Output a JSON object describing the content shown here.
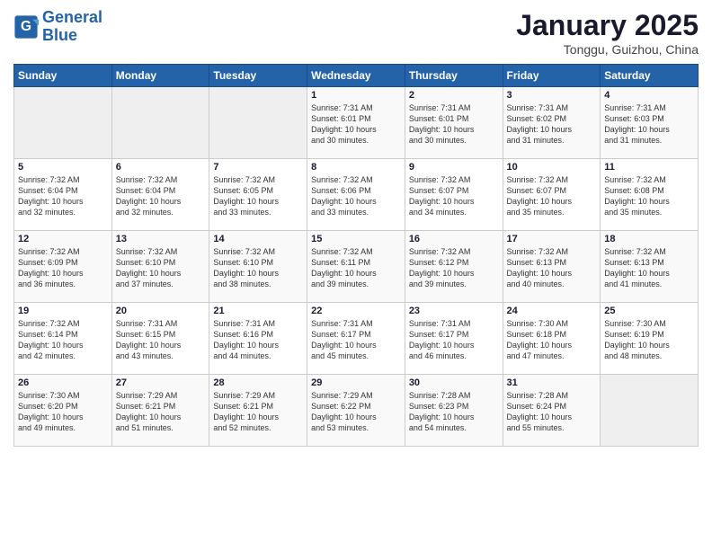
{
  "header": {
    "logo_line1": "General",
    "logo_line2": "Blue",
    "month_title": "January 2025",
    "location": "Tonggu, Guizhou, China"
  },
  "weekdays": [
    "Sunday",
    "Monday",
    "Tuesday",
    "Wednesday",
    "Thursday",
    "Friday",
    "Saturday"
  ],
  "weeks": [
    [
      {
        "day": "",
        "info": ""
      },
      {
        "day": "",
        "info": ""
      },
      {
        "day": "",
        "info": ""
      },
      {
        "day": "1",
        "info": "Sunrise: 7:31 AM\nSunset: 6:01 PM\nDaylight: 10 hours\nand 30 minutes."
      },
      {
        "day": "2",
        "info": "Sunrise: 7:31 AM\nSunset: 6:01 PM\nDaylight: 10 hours\nand 30 minutes."
      },
      {
        "day": "3",
        "info": "Sunrise: 7:31 AM\nSunset: 6:02 PM\nDaylight: 10 hours\nand 31 minutes."
      },
      {
        "day": "4",
        "info": "Sunrise: 7:31 AM\nSunset: 6:03 PM\nDaylight: 10 hours\nand 31 minutes."
      }
    ],
    [
      {
        "day": "5",
        "info": "Sunrise: 7:32 AM\nSunset: 6:04 PM\nDaylight: 10 hours\nand 32 minutes."
      },
      {
        "day": "6",
        "info": "Sunrise: 7:32 AM\nSunset: 6:04 PM\nDaylight: 10 hours\nand 32 minutes."
      },
      {
        "day": "7",
        "info": "Sunrise: 7:32 AM\nSunset: 6:05 PM\nDaylight: 10 hours\nand 33 minutes."
      },
      {
        "day": "8",
        "info": "Sunrise: 7:32 AM\nSunset: 6:06 PM\nDaylight: 10 hours\nand 33 minutes."
      },
      {
        "day": "9",
        "info": "Sunrise: 7:32 AM\nSunset: 6:07 PM\nDaylight: 10 hours\nand 34 minutes."
      },
      {
        "day": "10",
        "info": "Sunrise: 7:32 AM\nSunset: 6:07 PM\nDaylight: 10 hours\nand 35 minutes."
      },
      {
        "day": "11",
        "info": "Sunrise: 7:32 AM\nSunset: 6:08 PM\nDaylight: 10 hours\nand 35 minutes."
      }
    ],
    [
      {
        "day": "12",
        "info": "Sunrise: 7:32 AM\nSunset: 6:09 PM\nDaylight: 10 hours\nand 36 minutes."
      },
      {
        "day": "13",
        "info": "Sunrise: 7:32 AM\nSunset: 6:10 PM\nDaylight: 10 hours\nand 37 minutes."
      },
      {
        "day": "14",
        "info": "Sunrise: 7:32 AM\nSunset: 6:10 PM\nDaylight: 10 hours\nand 38 minutes."
      },
      {
        "day": "15",
        "info": "Sunrise: 7:32 AM\nSunset: 6:11 PM\nDaylight: 10 hours\nand 39 minutes."
      },
      {
        "day": "16",
        "info": "Sunrise: 7:32 AM\nSunset: 6:12 PM\nDaylight: 10 hours\nand 39 minutes."
      },
      {
        "day": "17",
        "info": "Sunrise: 7:32 AM\nSunset: 6:13 PM\nDaylight: 10 hours\nand 40 minutes."
      },
      {
        "day": "18",
        "info": "Sunrise: 7:32 AM\nSunset: 6:13 PM\nDaylight: 10 hours\nand 41 minutes."
      }
    ],
    [
      {
        "day": "19",
        "info": "Sunrise: 7:32 AM\nSunset: 6:14 PM\nDaylight: 10 hours\nand 42 minutes."
      },
      {
        "day": "20",
        "info": "Sunrise: 7:31 AM\nSunset: 6:15 PM\nDaylight: 10 hours\nand 43 minutes."
      },
      {
        "day": "21",
        "info": "Sunrise: 7:31 AM\nSunset: 6:16 PM\nDaylight: 10 hours\nand 44 minutes."
      },
      {
        "day": "22",
        "info": "Sunrise: 7:31 AM\nSunset: 6:17 PM\nDaylight: 10 hours\nand 45 minutes."
      },
      {
        "day": "23",
        "info": "Sunrise: 7:31 AM\nSunset: 6:17 PM\nDaylight: 10 hours\nand 46 minutes."
      },
      {
        "day": "24",
        "info": "Sunrise: 7:30 AM\nSunset: 6:18 PM\nDaylight: 10 hours\nand 47 minutes."
      },
      {
        "day": "25",
        "info": "Sunrise: 7:30 AM\nSunset: 6:19 PM\nDaylight: 10 hours\nand 48 minutes."
      }
    ],
    [
      {
        "day": "26",
        "info": "Sunrise: 7:30 AM\nSunset: 6:20 PM\nDaylight: 10 hours\nand 49 minutes."
      },
      {
        "day": "27",
        "info": "Sunrise: 7:29 AM\nSunset: 6:21 PM\nDaylight: 10 hours\nand 51 minutes."
      },
      {
        "day": "28",
        "info": "Sunrise: 7:29 AM\nSunset: 6:21 PM\nDaylight: 10 hours\nand 52 minutes."
      },
      {
        "day": "29",
        "info": "Sunrise: 7:29 AM\nSunset: 6:22 PM\nDaylight: 10 hours\nand 53 minutes."
      },
      {
        "day": "30",
        "info": "Sunrise: 7:28 AM\nSunset: 6:23 PM\nDaylight: 10 hours\nand 54 minutes."
      },
      {
        "day": "31",
        "info": "Sunrise: 7:28 AM\nSunset: 6:24 PM\nDaylight: 10 hours\nand 55 minutes."
      },
      {
        "day": "",
        "info": ""
      }
    ]
  ]
}
